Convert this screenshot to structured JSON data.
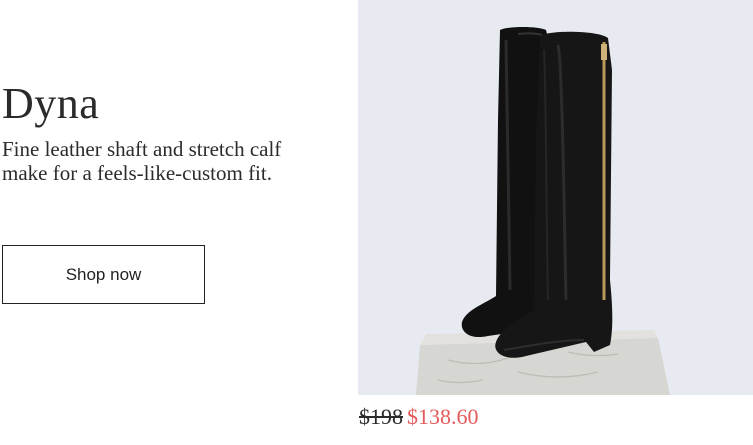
{
  "product": {
    "name": "Dyna",
    "description": "Fine leather shaft and stretch calf make for a feels-like-custom fit.",
    "cta_label": "Shop now",
    "price_original": "$198",
    "price_sale": "$138.60"
  },
  "image": {
    "icon": "boot-photo",
    "background_color": "#e7eaf1",
    "sale_color": "#e45a5a"
  }
}
